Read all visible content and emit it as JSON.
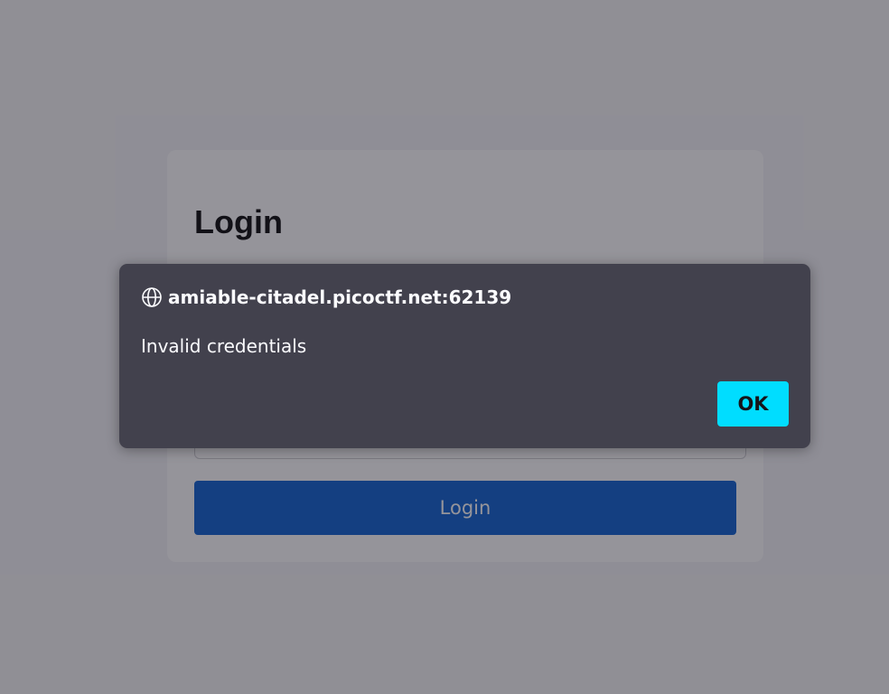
{
  "login": {
    "title": "Login",
    "submit_label": "Login",
    "username_value": "",
    "password_value": ""
  },
  "dialog": {
    "origin": "amiable-citadel.picoctf.net:62139",
    "origin_icon": "globe-icon",
    "message": "Invalid credentials",
    "ok_label": "OK"
  },
  "colors": {
    "submit_button": "#1465d2",
    "dialog_background": "#42414d",
    "ok_button": "#00ddff"
  }
}
